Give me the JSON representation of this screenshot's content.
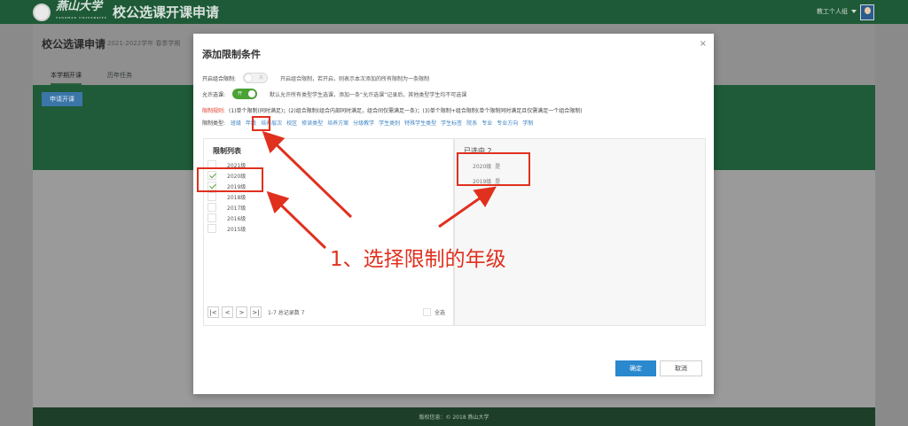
{
  "header": {
    "logo_text": "燕山大学",
    "logo_sub": "YANSHAN UNIVERSITY",
    "app_title": "校公选课开课申请",
    "user": "教工个人组"
  },
  "page": {
    "title": "校公选课申请",
    "term": "2021-2022学年 春季学期",
    "tabs": [
      "本学期开课",
      "历年任务"
    ],
    "apply_button": "申请开课",
    "footer": "版权信息：© 2018 燕山大学"
  },
  "modal": {
    "title": "添加限制条件",
    "close": "×",
    "combo_label": "开启组合限制:",
    "combo_toggle": "关",
    "combo_desc": "开启组合限制，若开启，则表示本次添加的所有限制为一条限制",
    "allow_label": "允许选课:",
    "allow_toggle": "开",
    "allow_desc": "默认允许所有类型学生选课，添加一条“允许选课”记录后，其他类型学生均不可选课",
    "rules_label": "限制规则:",
    "rules_text": "(1)单个限制(同时满足)；(2)组合限制(组合内部同时满足，组合间仅需满足一条)；(3)单个限制+组合限制(单个限制同时满足且仅需满足一个组合限制)",
    "types_label": "限制类型:",
    "types": [
      "班级",
      "年级",
      "培养层次",
      "校区",
      "修读类型",
      "培养方案",
      "分级教学",
      "学生类别",
      "特殊学生类型",
      "学生标签",
      "院系",
      "专业",
      "专业方向",
      "学制"
    ],
    "list_title": "限制列表",
    "list": [
      {
        "label": "2021级",
        "checked": false
      },
      {
        "label": "2020级",
        "checked": true
      },
      {
        "label": "2019级",
        "checked": true
      },
      {
        "label": "2018级",
        "checked": false
      },
      {
        "label": "2017级",
        "checked": false
      },
      {
        "label": "2016级",
        "checked": false
      },
      {
        "label": "2015级",
        "checked": false
      }
    ],
    "pager": {
      "first": "|<",
      "prev": "<",
      "next": ">",
      "last": ">|",
      "summary": "1-7 总记录数 7"
    },
    "select_all": "全选",
    "selected_title": "已选中 2",
    "selected": [
      {
        "label": "2020级",
        "value": "是"
      },
      {
        "label": "2019级",
        "value": "是"
      }
    ],
    "ok": "确定",
    "cancel": "取消"
  },
  "annotation": "1、选择限制的年级",
  "colors": {
    "header_green": "#1e5a37",
    "highlight_red": "#e0301e",
    "primary_blue": "#2a88cf",
    "toggle_green": "#4aa335"
  }
}
